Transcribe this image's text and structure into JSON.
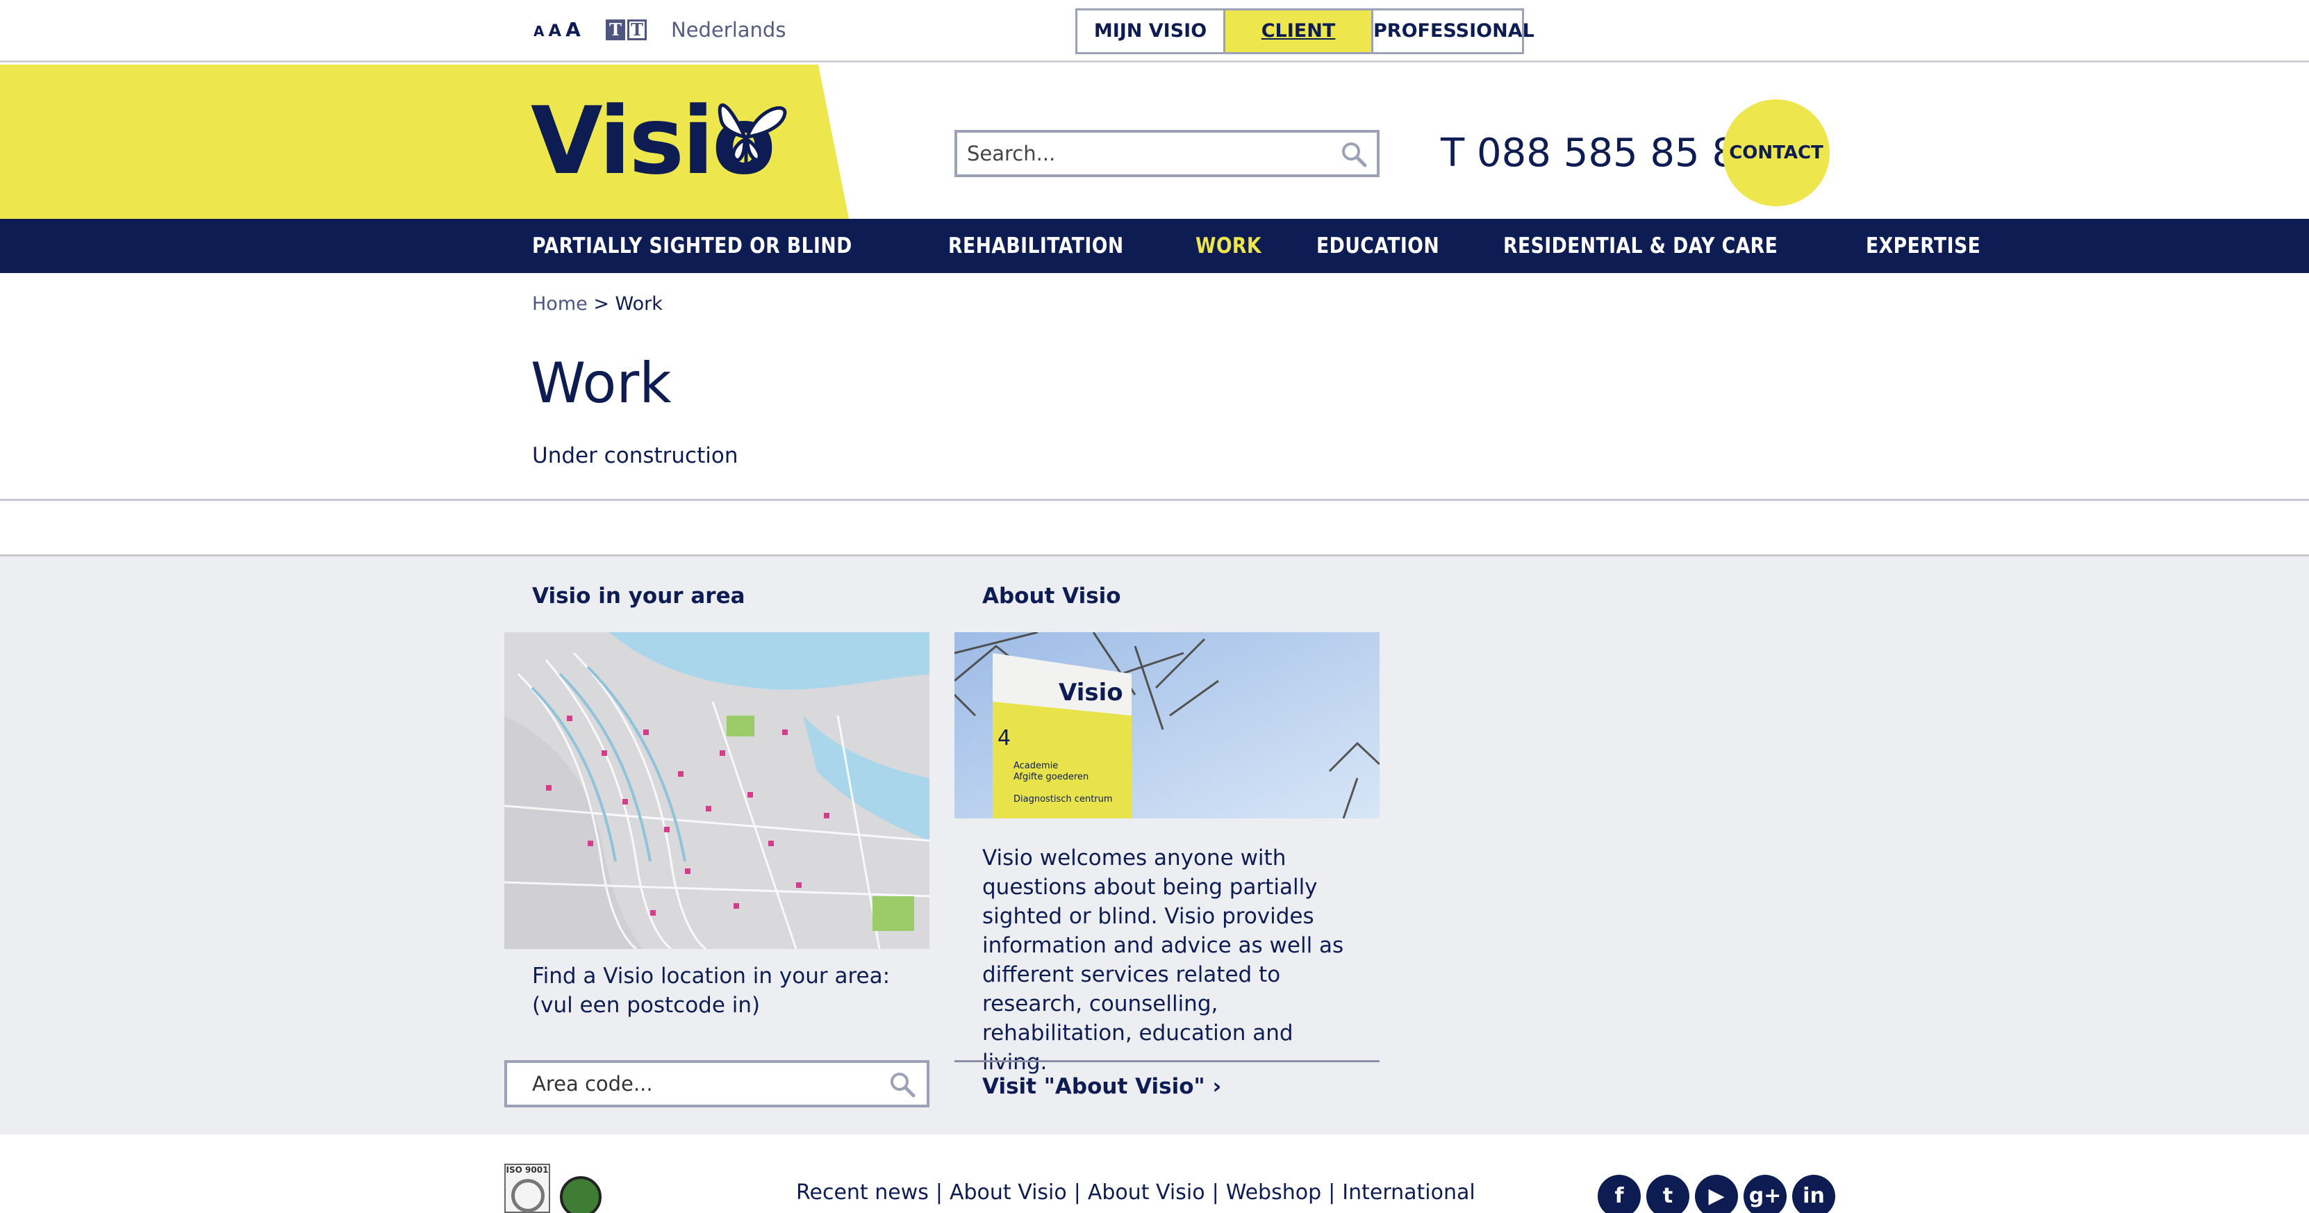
{
  "topbar": {
    "font_size_labels": [
      "A",
      "A",
      "A"
    ],
    "contrast_labels": [
      "T",
      "T"
    ],
    "language_link": "Nederlands",
    "segments": [
      {
        "label": "MIJN VISIO"
      },
      {
        "label": "CLIENT",
        "active": true
      },
      {
        "label": "PROFESSIONAL"
      }
    ]
  },
  "header": {
    "logo_text": "Visio",
    "search_placeholder": "Search...",
    "phone": "T 088 585 85 85",
    "contact_label": "CONTACT"
  },
  "nav": {
    "items": [
      {
        "label": "PARTIALLY SIGHTED OR BLIND"
      },
      {
        "label": "REHABILITATION"
      },
      {
        "label": "WORK",
        "active": true
      },
      {
        "label": "EDUCATION"
      },
      {
        "label": "RESIDENTIAL & DAY CARE"
      },
      {
        "label": "EXPERTISE"
      }
    ]
  },
  "breadcrumb": {
    "home": "Home",
    "separator": ">",
    "current": "Work"
  },
  "main": {
    "title": "Work",
    "intro": "Under construction"
  },
  "area": {
    "title": "Visio in your area",
    "text": "Find a Visio location in your area: (vul een postcode in)",
    "input_placeholder": "Area code..."
  },
  "about": {
    "title": "About Visio",
    "sign_text": "Visio",
    "sign_number": "4",
    "sign_line1": "Academie",
    "sign_line2": "Afgifte goederen",
    "sign_line3": "Diagnostisch centrum",
    "text": "Visio welcomes anyone with questions about being partially sighted or blind. Visio provides information and advice as well as different services related to research, counselling, rehabilitation, education and living.",
    "link": "Visit \"About Visio\""
  },
  "footer": {
    "iso_label": "ISO 9001",
    "links": [
      "Recent news",
      "About Visio",
      "About Visio",
      "Webshop",
      "International"
    ],
    "separator": "|",
    "socials": [
      {
        "icon": "facebook-icon",
        "glyph": "f"
      },
      {
        "icon": "twitter-icon",
        "glyph": "t"
      },
      {
        "icon": "youtube-icon",
        "glyph": "▶"
      },
      {
        "icon": "googleplus-icon",
        "glyph": "g+"
      },
      {
        "icon": "linkedin-icon",
        "glyph": "in"
      }
    ]
  },
  "colors": {
    "navy": "#0e1c54",
    "yellow": "#ede64c",
    "panel_grey": "#eceef2"
  }
}
